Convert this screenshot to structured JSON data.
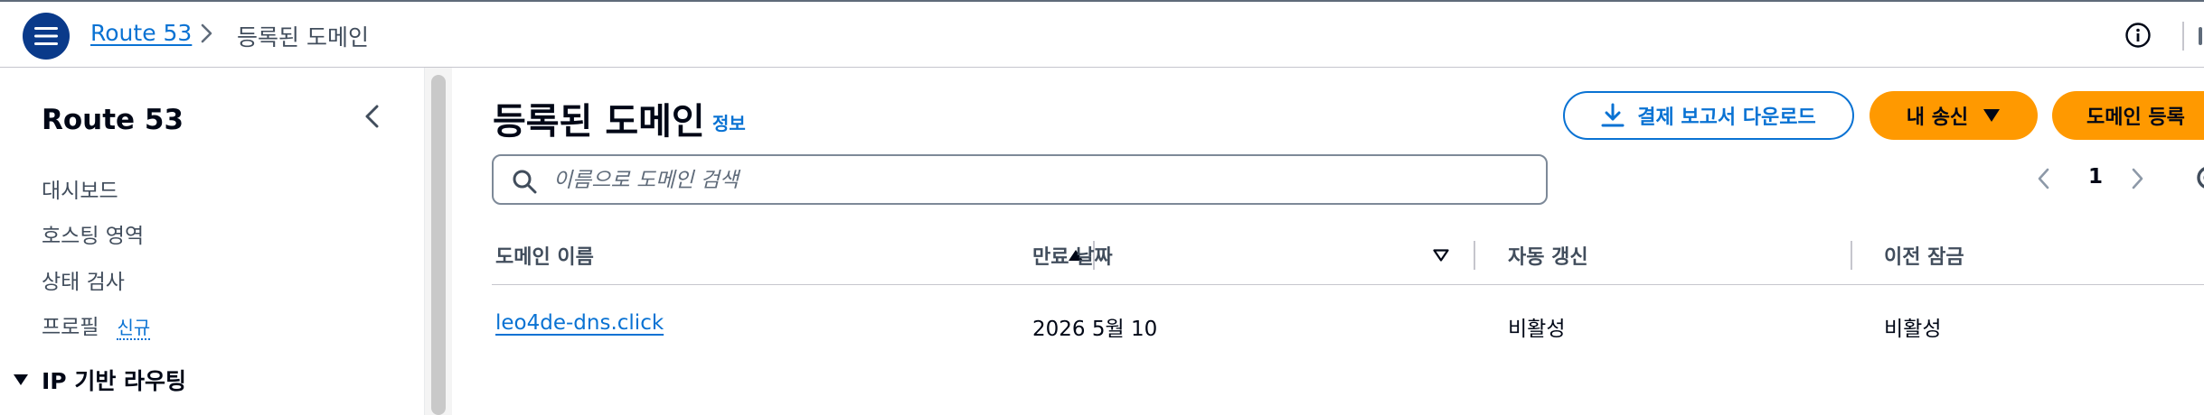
{
  "header": {
    "breadcrumb_root": "Route 53",
    "breadcrumb_current": "등록된 도메인"
  },
  "sidebar": {
    "title": "Route 53",
    "items": [
      {
        "label": "대시보드"
      },
      {
        "label": "호스팅 영역"
      },
      {
        "label": "상태 검사"
      },
      {
        "label": "프로필",
        "badge": "신규"
      }
    ],
    "section": "IP 기반 라우팅"
  },
  "main": {
    "title": "등록된 도메인",
    "info_link": "정보",
    "download_button": "결제 보고서 다운로드",
    "sent_button": "내 송신",
    "register_button": "도메인 등록",
    "search_placeholder": "이름으로 도메인 검색",
    "page_number": "1"
  },
  "table": {
    "columns": [
      "도메인 이름",
      "만료 날짜",
      "자동 갱신",
      "이전 잠금"
    ],
    "rows": [
      {
        "domain": "leo4de-dns.click",
        "expiry": "2026 5월 10",
        "auto_renew": "비활성",
        "transfer_lock": "비활성"
      }
    ]
  },
  "colors": {
    "link": "#0972d3",
    "primary_button": "#ff9900",
    "menu_button": "#0a3a8a"
  }
}
